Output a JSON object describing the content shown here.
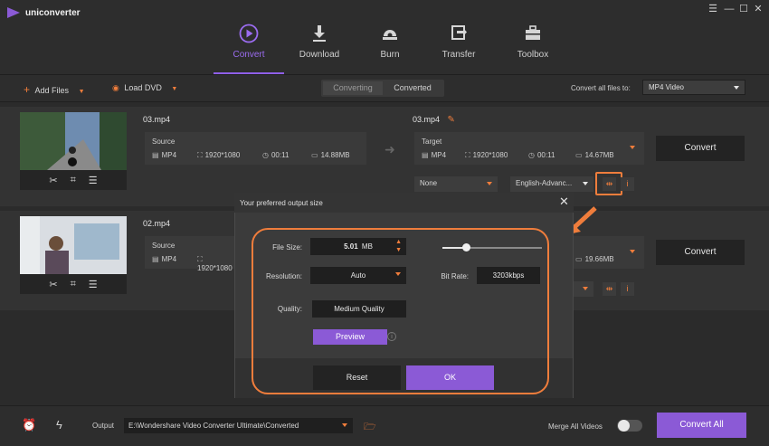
{
  "app": {
    "name": "uniconverter"
  },
  "nav": {
    "items": [
      {
        "label": "Convert",
        "icon": "convert-icon",
        "active": true
      },
      {
        "label": "Download",
        "icon": "download-icon"
      },
      {
        "label": "Burn",
        "icon": "burn-icon"
      },
      {
        "label": "Transfer",
        "icon": "transfer-icon"
      },
      {
        "label": "Toolbox",
        "icon": "toolbox-icon"
      }
    ]
  },
  "toolbar": {
    "add_files": "Add Files",
    "load_dvd": "Load DVD",
    "tab_converting": "Converting",
    "tab_converted": "Converted",
    "convert_all_to_label": "Convert all files to:",
    "format_value": "MP4 Video"
  },
  "files": [
    {
      "name": "03.mp4",
      "source": {
        "label": "Source",
        "format": "MP4",
        "resolution": "1920*1080",
        "duration": "00:11",
        "size": "14.88MB"
      },
      "target": {
        "name": "03.mp4",
        "label": "Target",
        "format": "MP4",
        "resolution": "1920*1080",
        "duration": "00:11",
        "size": "14.67MB"
      },
      "subtitle": "None",
      "audio": "English-Advanc...",
      "convert_label": "Convert"
    },
    {
      "name": "02.mp4",
      "source": {
        "label": "Source",
        "format": "MP4",
        "resolution": "1920*1080"
      },
      "target": {
        "size": "19.66MB"
      },
      "convert_label": "Convert"
    }
  ],
  "modal": {
    "title": "Your preferred output size",
    "file_size_label": "File Size:",
    "file_size_value": "5.01",
    "file_size_unit": "MB",
    "resolution_label": "Resolution:",
    "resolution_value": "Auto",
    "bitrate_label": "Bit Rate:",
    "bitrate_value": "3203kbps",
    "quality_label": "Quality:",
    "quality_value": "Medium Quality",
    "preview_label": "Preview",
    "reset_label": "Reset",
    "ok_label": "OK",
    "slider_fraction": 0.24
  },
  "bottom": {
    "output_label": "Output",
    "output_path": "E:\\Wondershare Video Converter Ultimate\\Converted",
    "merge_label": "Merge All Videos",
    "convert_all_label": "Convert All"
  },
  "colors": {
    "accent": "#8b5ad6",
    "highlight": "#ef7d3c"
  }
}
